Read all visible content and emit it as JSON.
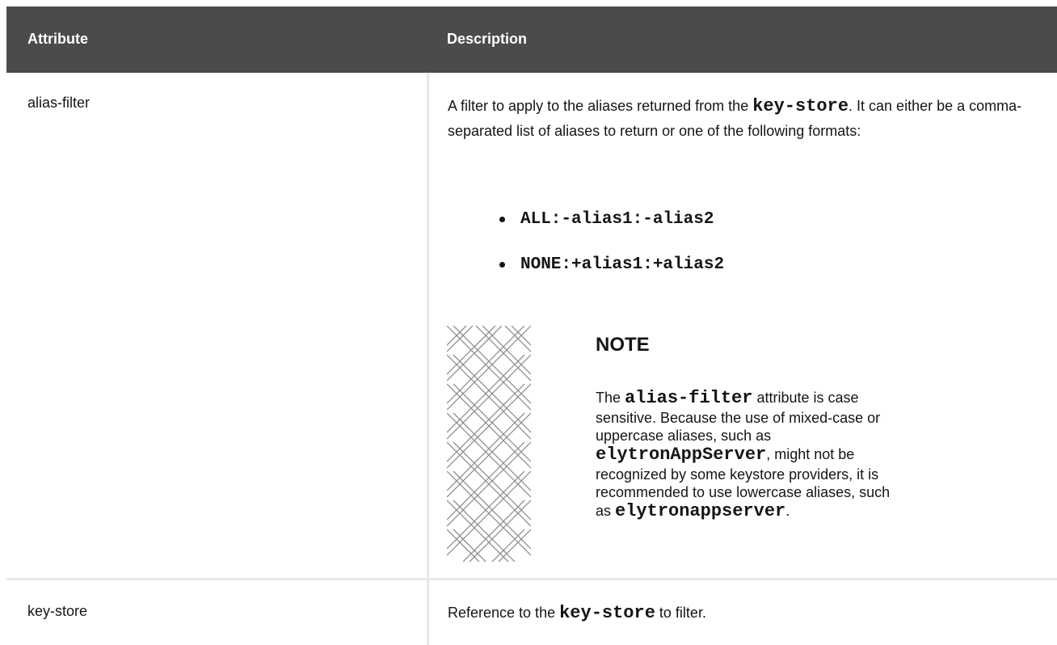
{
  "table": {
    "headers": {
      "attribute": "Attribute",
      "description": "Description"
    },
    "rows": [
      {
        "attribute": "alias-filter",
        "description": {
          "part1": "A filter to apply to the aliases returned from the ",
          "code1": "key-store",
          "part2": ". It can either be a comma-separated list of aliases to return or one of the following formats:",
          "formats": [
            "ALL:-alias1:-alias2",
            "NONE:+alias1:+alias2"
          ],
          "note": {
            "title": "NOTE",
            "part1": "The ",
            "code1": "alias-filter",
            "part2": " attribute is case sensitive. Because the use of mixed-case or uppercase aliases, such as ",
            "code2": "elytronAppServer",
            "part3": ", might not be recognized by some keystore providers, it is recommended to use lowercase aliases, such as ",
            "code3": "elytronappserver",
            "part4": "."
          }
        }
      },
      {
        "attribute": "key-store",
        "description": {
          "part1": "Reference to the ",
          "code1": "key-store",
          "part2": " to filter."
        }
      }
    ]
  }
}
